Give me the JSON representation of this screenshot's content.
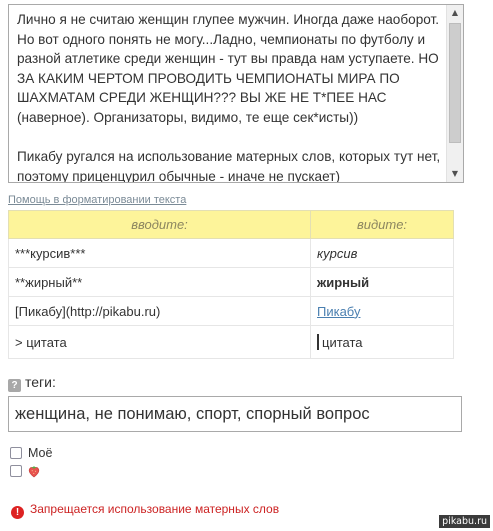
{
  "editor": {
    "paragraph1": "Лично я не считаю женщин глупее мужчин. Иногда даже наоборот. Но вот одного понять не могу...Ладно, чемпионаты по футболу и разной атлетике среди женщин - тут вы правда нам уступаете. НО ЗА КАКИМ ЧЕРТОМ ПРОВОДИТЬ ЧЕМПИОНАТЫ МИРА ПО ШАХМАТАМ СРЕДИ ЖЕНЩИН??? ВЫ ЖЕ НЕ Т*ПЕЕ НАС (наверное). Организаторы, видимо, те еще сек*исты))",
    "paragraph2": "Пикабу ругался на использование матерных слов, которых тут нет, поэтому приценцурил обычные - иначе не пускает)",
    "scroll_up_icon": "triangle-up-icon",
    "scroll_down_icon": "triangle-down-icon"
  },
  "help_link": "Помощь в форматировании текста",
  "format_table": {
    "header_input": "вводите:",
    "header_output": "видите:",
    "rows": [
      {
        "input": "***курсив***",
        "output": "курсив",
        "style": "italic"
      },
      {
        "input": "**жирный**",
        "output": "жирный",
        "style": "bold"
      },
      {
        "input": "[Пикабу](http://pikabu.ru)",
        "output": "Пикабу",
        "style": "link"
      },
      {
        "input": "> цитата",
        "output": "цитата",
        "style": "quote"
      }
    ]
  },
  "tags": {
    "label": "теги:",
    "help_icon": "?",
    "value": "женщина, не понимаю, спорт, спорный вопрос"
  },
  "options": {
    "mine_label": "Моё",
    "strawberry_icon": "strawberry-icon"
  },
  "warning": {
    "icon": "!",
    "text": "Запрещается использование матерных слов"
  },
  "watermark": "pikabu.ru",
  "colors": {
    "table_header_bg": "#fdf49a",
    "warning_red": "#cc2222",
    "link_blue": "#4a7fb0"
  }
}
